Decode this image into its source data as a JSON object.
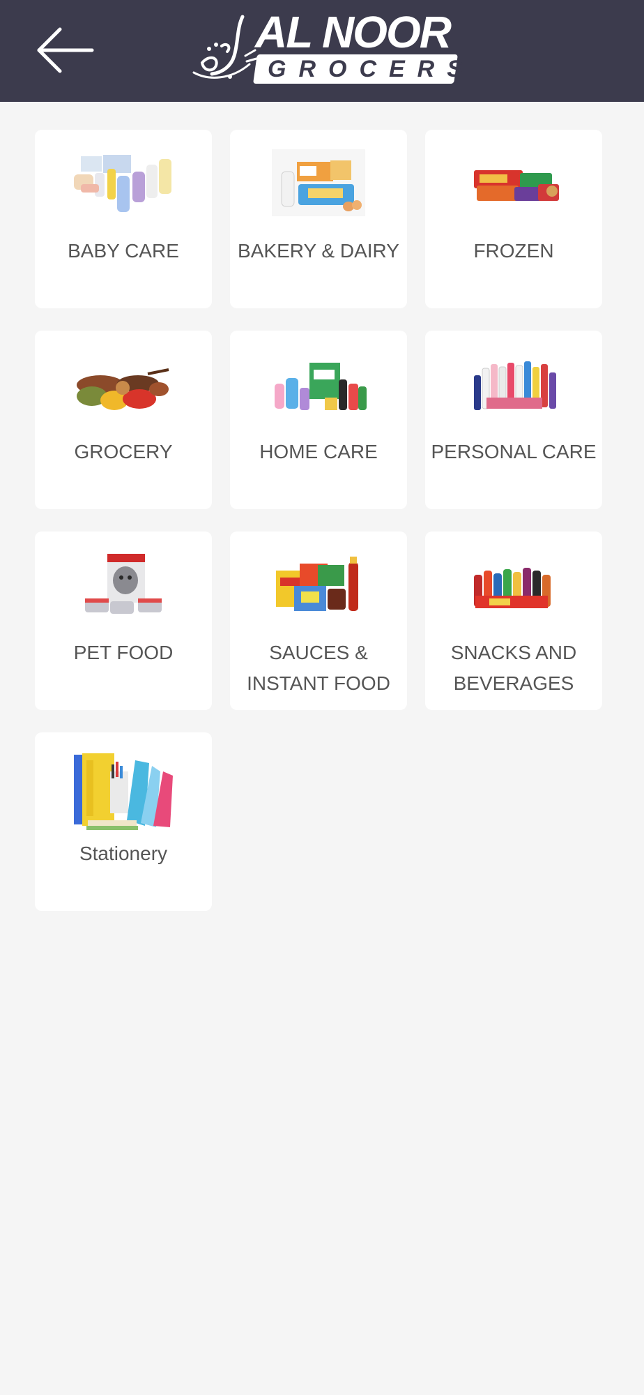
{
  "header": {
    "background": "#3c3b4d",
    "back_icon": "arrow-left-icon",
    "logo": {
      "arabic_script": "النور",
      "title": "AL NOOR",
      "subtitle": "GROCERS"
    }
  },
  "categories": [
    {
      "label": "BABY CARE",
      "icon": "baby-care-products-image"
    },
    {
      "label": "BAKERY & DAIRY",
      "icon": "bakery-dairy-products-image"
    },
    {
      "label": "FROZEN",
      "icon": "frozen-products-image"
    },
    {
      "label": "GROCERY",
      "icon": "grocery-spices-image"
    },
    {
      "label": "HOME CARE",
      "icon": "home-care-products-image"
    },
    {
      "label": "PERSONAL CARE",
      "icon": "personal-care-products-image"
    },
    {
      "label": "PET FOOD",
      "icon": "pet-food-image"
    },
    {
      "label": "SAUCES &\nINSTANT FOOD",
      "icon": "sauces-instant-food-image"
    },
    {
      "label": "SNACKS AND\nBEVERAGES",
      "icon": "snacks-beverages-image"
    },
    {
      "label": "Stationery",
      "icon": "stationery-image"
    }
  ]
}
